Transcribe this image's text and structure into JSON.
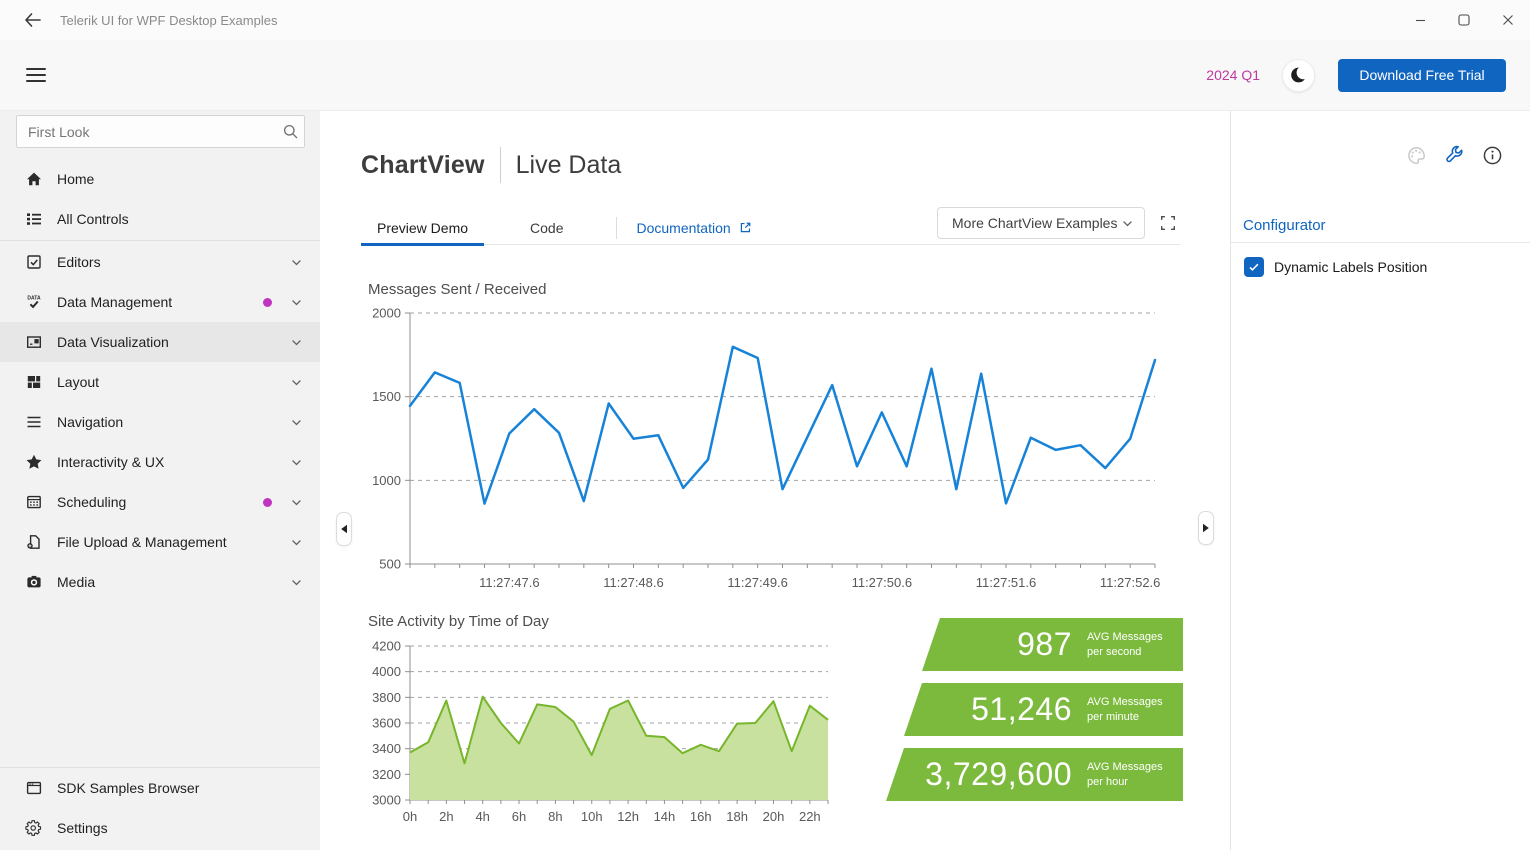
{
  "window": {
    "title": "Telerik UI for WPF Desktop Examples",
    "controls": [
      {
        "name": "minimize",
        "icon": "minimize-icon"
      },
      {
        "name": "maximize",
        "icon": "maximize-icon"
      },
      {
        "name": "close",
        "icon": "close-icon"
      }
    ]
  },
  "toolbar": {
    "release": "2024 Q1",
    "theme_icon": "moon-icon",
    "download_label": "Download Free Trial"
  },
  "sidebar": {
    "search_placeholder": "First Look",
    "items": [
      {
        "icon": "home-icon",
        "label": "Home"
      },
      {
        "icon": "all-controls-icon",
        "label": "All Controls",
        "divider_after": true
      },
      {
        "icon": "editors-icon",
        "label": "Editors",
        "expandable": true
      },
      {
        "icon": "data-management-icon",
        "label": "Data Management",
        "expandable": true,
        "badge_dot": true
      },
      {
        "icon": "data-visualization-icon",
        "label": "Data Visualization",
        "expandable": true,
        "selected": true
      },
      {
        "icon": "layout-icon",
        "label": "Layout",
        "expandable": true
      },
      {
        "icon": "navigation-icon",
        "label": "Navigation",
        "expandable": true
      },
      {
        "icon": "interactivity-icon",
        "label": "Interactivity & UX",
        "expandable": true
      },
      {
        "icon": "scheduling-icon",
        "label": "Scheduling",
        "expandable": true,
        "badge_dot": true
      },
      {
        "icon": "file-upload-icon",
        "label": "File Upload & Management",
        "expandable": true
      },
      {
        "icon": "media-icon",
        "label": "Media",
        "expandable": true
      }
    ],
    "bottom_items": [
      {
        "icon": "sdk-icon",
        "label": "SDK Samples Browser"
      },
      {
        "icon": "settings-icon",
        "label": "Settings"
      }
    ]
  },
  "header": {
    "control": "ChartView",
    "example": "Live Data"
  },
  "tabs": {
    "preview": "Preview Demo",
    "code": "Code",
    "documentation": "Documentation"
  },
  "examples_dropdown": {
    "label": "More ChartView Examples"
  },
  "stats": [
    {
      "value": "987",
      "caption_line1": "AVG Messages",
      "caption_line2": "per second"
    },
    {
      "value": "51,246",
      "caption_line1": "AVG Messages",
      "caption_line2": "per minute"
    },
    {
      "value": "3,729,600",
      "caption_line1": "AVG Messages",
      "caption_line2": "per hour"
    }
  ],
  "configurator": {
    "title": "Configurator",
    "options": [
      {
        "label": "Dynamic Labels Position",
        "checked": true
      }
    ]
  },
  "colors": {
    "accent": "#1065c0",
    "release": "#bf3a9e",
    "dot": "#bf35bf",
    "line_blue": "#1783d8",
    "badge_green": "#7cba3d",
    "area_stroke": "#77b52b",
    "area_fill": "#c8e19e"
  },
  "chart_data": [
    {
      "type": "line",
      "title": "Messages Sent / Received",
      "ylabel": "",
      "xlabel": "",
      "ylim": [
        500,
        2000
      ],
      "yticks": [
        500,
        1000,
        1500,
        2000
      ],
      "grid": "horizontal-dashed",
      "x_domain_seconds": [
        46.8,
        52.8
      ],
      "x_step_seconds": 0.2,
      "x_tick_labels": [
        "11:27:47.6",
        "11:27:48.6",
        "11:27:49.6",
        "11:27:50.6",
        "11:27:51.6",
        "11:27:52.6"
      ],
      "x_tick_times": [
        47.6,
        48.6,
        49.6,
        50.6,
        51.6,
        52.6
      ],
      "values": [
        1445,
        1645,
        1582,
        861,
        1280,
        1425,
        1284,
        876,
        1459,
        1249,
        1269,
        955,
        1124,
        1798,
        1731,
        947,
        1258,
        1569,
        1084,
        1406,
        1084,
        1667,
        947,
        1637,
        862,
        1255,
        1182,
        1210,
        1073,
        1249,
        1719
      ],
      "line_color": "#1783d8"
    },
    {
      "type": "area",
      "title": "Site Activity by Time of Day",
      "ylabel": "",
      "xlabel": "",
      "ylim": [
        3000,
        4200
      ],
      "yticks": [
        3000,
        3200,
        3400,
        3600,
        3800,
        4000,
        4200
      ],
      "grid": "horizontal-dashed",
      "categories_hours": [
        0,
        1,
        2,
        3,
        4,
        5,
        6,
        7,
        8,
        9,
        10,
        11,
        12,
        13,
        14,
        15,
        16,
        17,
        18,
        19,
        20,
        21,
        22,
        23
      ],
      "x_tick_labels": [
        "0h",
        "2h",
        "4h",
        "6h",
        "8h",
        "10h",
        "12h",
        "14h",
        "16h",
        "18h",
        "20h",
        "22h"
      ],
      "x_tick_indices": [
        0,
        2,
        4,
        6,
        8,
        10,
        12,
        14,
        16,
        18,
        20,
        22
      ],
      "values": [
        3370,
        3450,
        3775,
        3285,
        3805,
        3600,
        3440,
        3745,
        3725,
        3610,
        3350,
        3710,
        3775,
        3500,
        3490,
        3365,
        3430,
        3380,
        3595,
        3600,
        3770,
        3380,
        3735,
        3625
      ],
      "stroke_color": "#77b52b",
      "fill_color": "#c8e19e"
    }
  ]
}
